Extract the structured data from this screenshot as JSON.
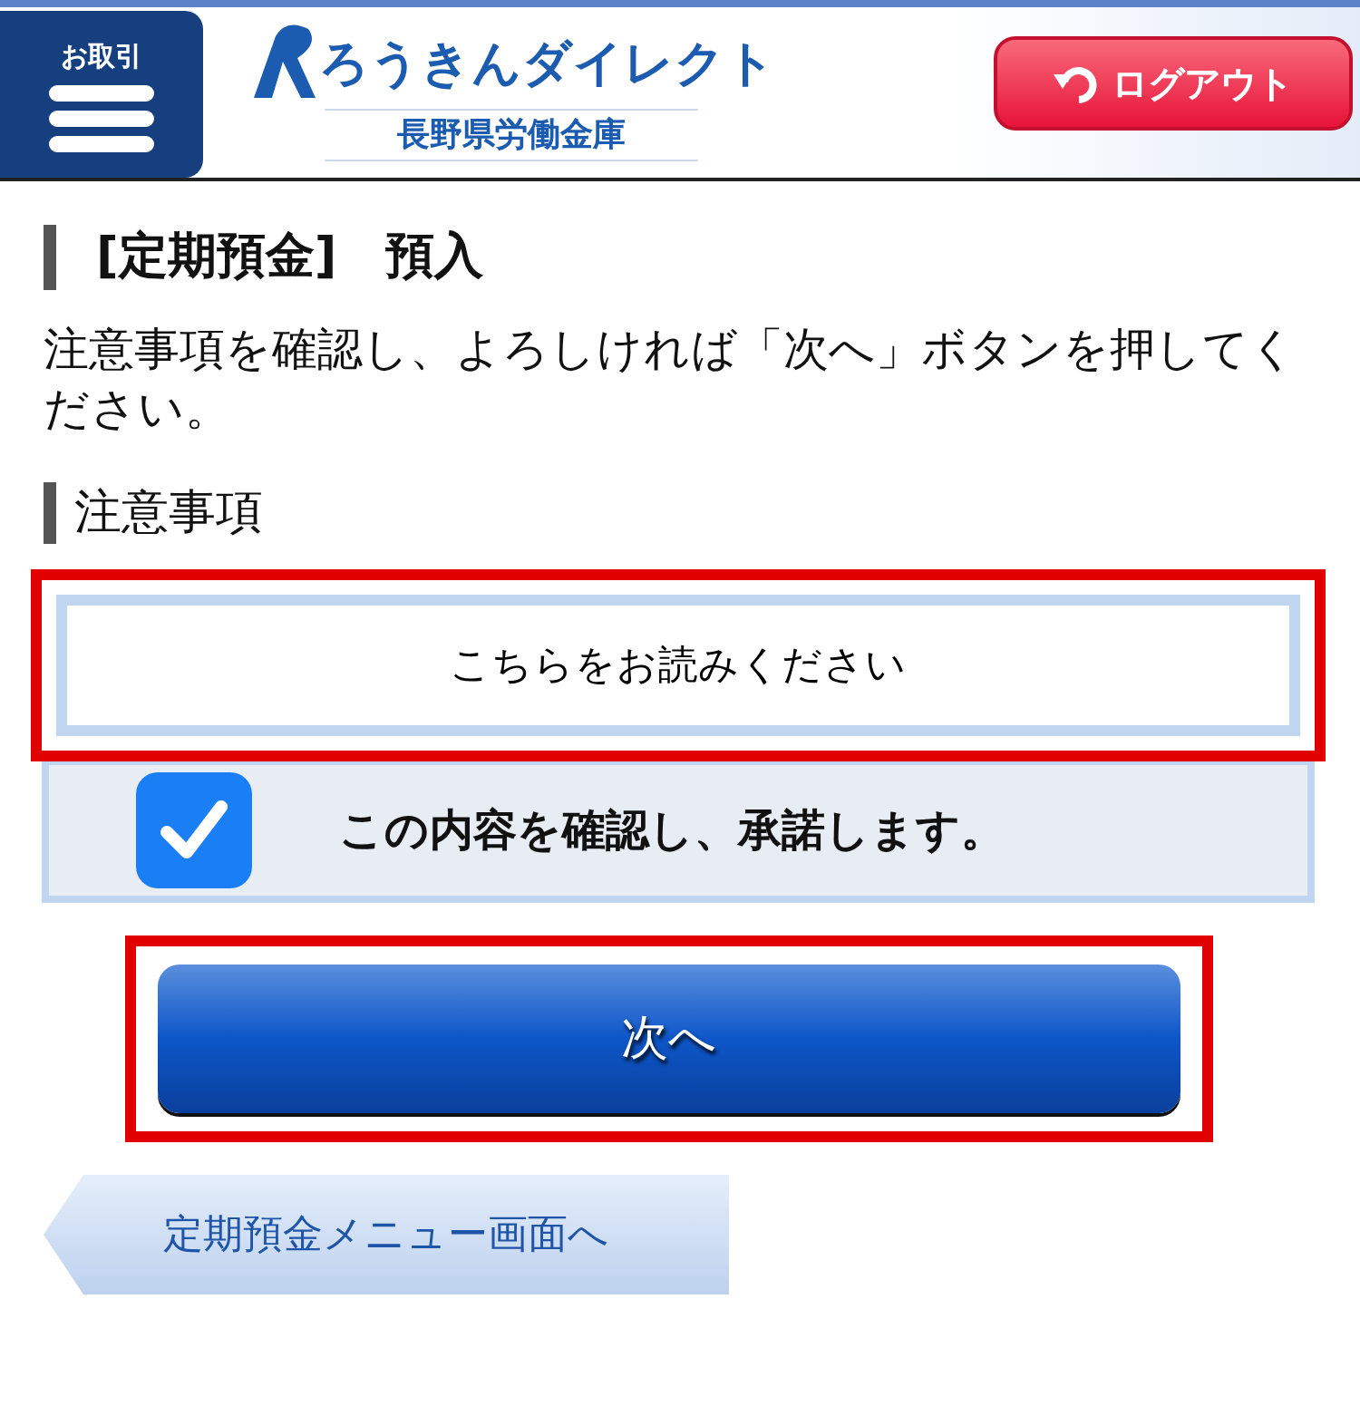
{
  "header": {
    "menu_label": "お取引",
    "brand": "ろうきんダイレクト",
    "bank": "長野県労働金庫",
    "logout": "ログアウト"
  },
  "page_title": "[定期預金]　預入",
  "instruction": "注意事項を確認し、よろしければ「次へ」ボタンを押してください。",
  "section_title": "注意事項",
  "notice_button": {
    "label": "こちらをお読みください",
    "highlighted": true
  },
  "agreement": {
    "label": "この内容を確認し、承諾します。",
    "checked": true
  },
  "next_button": {
    "label": "次へ",
    "highlighted": true
  },
  "back_button": {
    "label": "定期預金メニュー画面へ"
  }
}
